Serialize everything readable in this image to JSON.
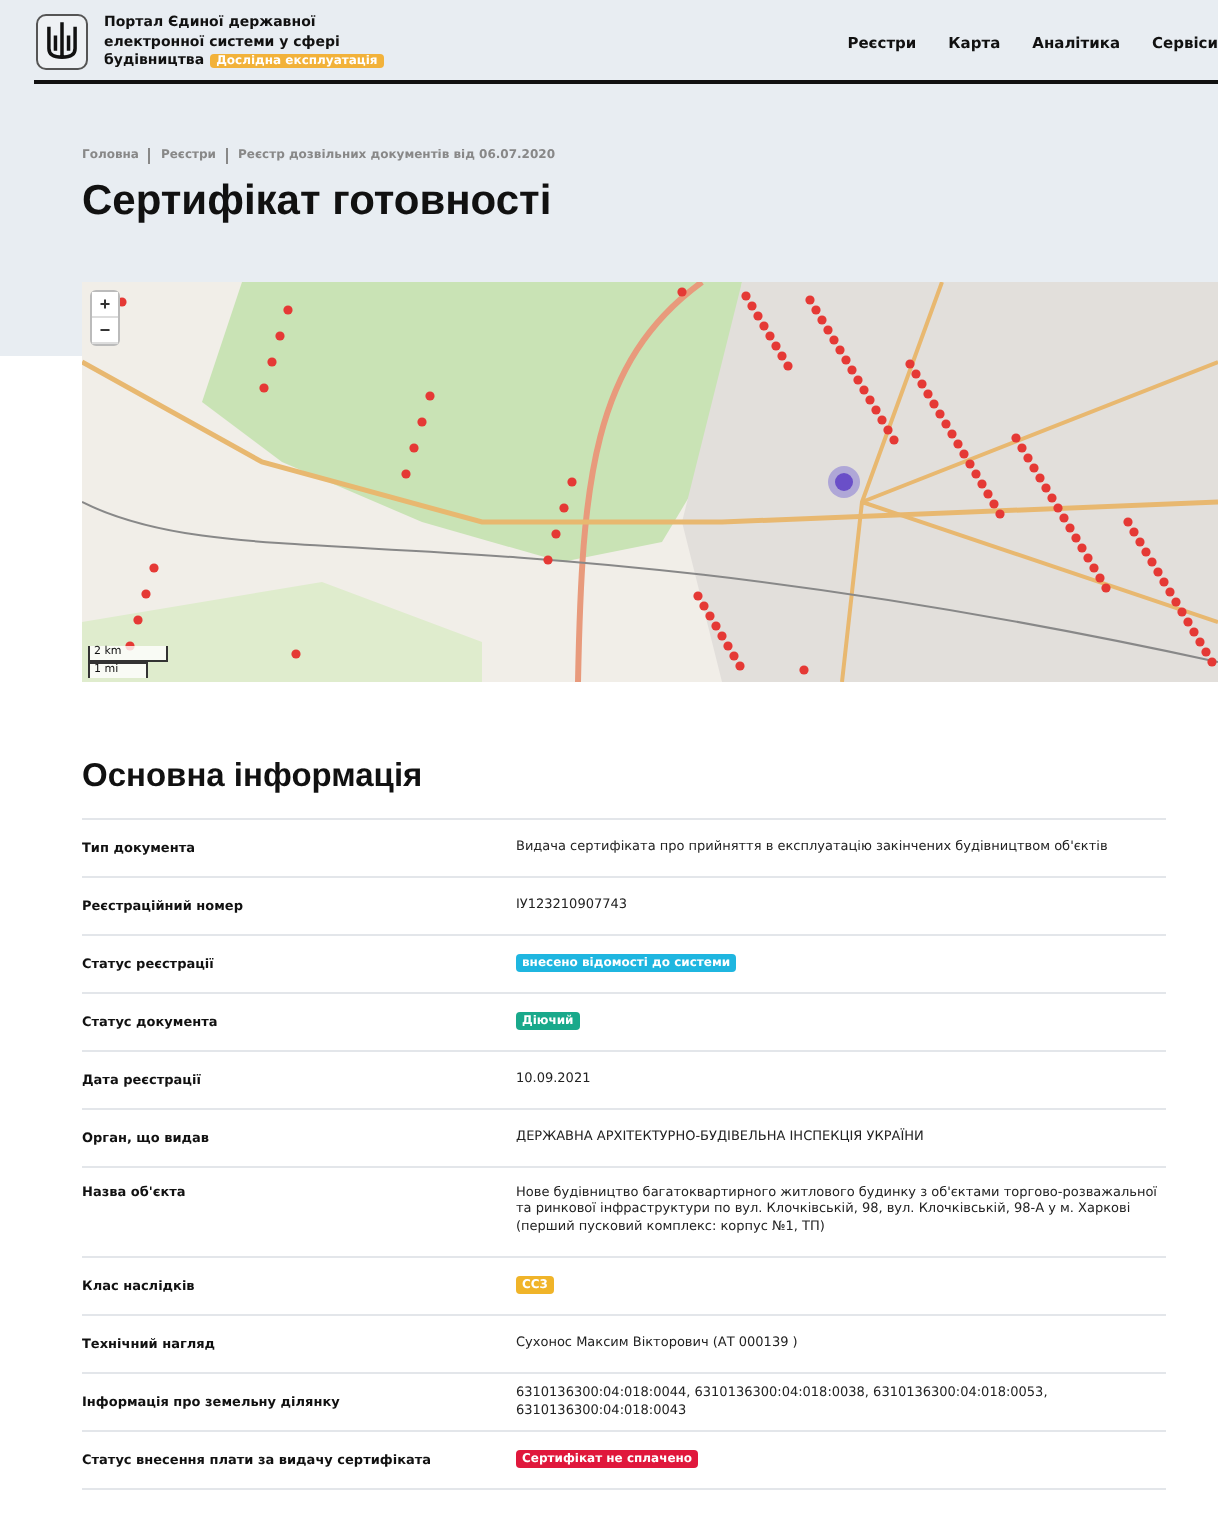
{
  "header": {
    "portal_title": "Портал Єдиної державної електронної системи у сфері будівництва",
    "badge": "Дослідна експлуатація",
    "nav": [
      "Реєстри",
      "Карта",
      "Аналітика",
      "Сервіси"
    ]
  },
  "breadcrumbs": [
    "Головна",
    "Реєстри",
    "Реєстр дозвільних документів від 06.07.2020"
  ],
  "page_title": "Сертифікат готовності",
  "map": {
    "zoom_in": "+",
    "zoom_out": "−",
    "scale": [
      "2 km",
      "1 mi"
    ]
  },
  "section_title": "Основна інформація",
  "rows": [
    {
      "label": "Тип документа",
      "kind": "text",
      "value": "Видача сертифіката про прийняття в експлуатацію закінчених будівництвом об'єктів"
    },
    {
      "label": "Реєстраційний номер",
      "kind": "text",
      "value": "ІУ123210907743"
    },
    {
      "label": "Статус реєстрації",
      "kind": "badge",
      "value": "внесено відомості до системи",
      "color": "#1fb6e0"
    },
    {
      "label": "Статус документа",
      "kind": "badge",
      "value": "Діючий",
      "color": "#19a98b"
    },
    {
      "label": "Дата реєстрації",
      "kind": "text",
      "value": "10.09.2021"
    },
    {
      "label": "Орган, що видав",
      "kind": "text",
      "value": "ДЕРЖАВНА АРХІТЕКТУРНО-БУДІВЕЛЬНА ІНСПЕКЦІЯ УКРАЇНИ"
    },
    {
      "label": "Назва об'єкта",
      "kind": "text",
      "value": "Нове будівництво багатоквартирного житлового будинку з об'єктами торгово-розважальної та ринкової інфраструктури по вул. Клочківській, 98, вул. Клочківській, 98-А у м. Харкові (перший пусковий комплекс: корпус №1, ТП)"
    },
    {
      "label": "Клас наслідків",
      "kind": "badge",
      "value": "СС3",
      "color": "#f0b429"
    },
    {
      "label": "Технічний нагляд",
      "kind": "text",
      "value": "Сухонос Максим Вікторович (АТ 000139 )"
    },
    {
      "label": "Інформація про земельну ділянку",
      "kind": "text",
      "value": "6310136300:04:018:0044, 6310136300:04:018:0038, 6310136300:04:018:0053, 6310136300:04:018:0043"
    },
    {
      "label": "Статус внесення плати за видачу сертифіката",
      "kind": "badge",
      "value": "Сертифікат не сплачено",
      "color": "#e0183c"
    }
  ]
}
